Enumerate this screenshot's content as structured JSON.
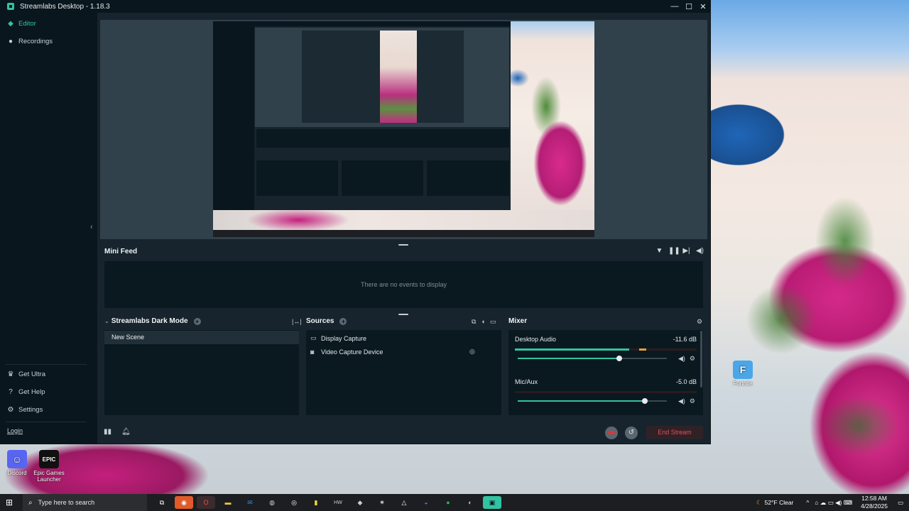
{
  "window": {
    "title": "Streamlabs Desktop - 1.18.3",
    "min": "—",
    "max": "☐",
    "close": "✕"
  },
  "sidebar": {
    "items": [
      {
        "label": "Editor",
        "icon": "◆"
      },
      {
        "label": "Recordings",
        "icon": "●"
      }
    ],
    "bottom": [
      {
        "label": "Get Ultra",
        "icon": "♛"
      },
      {
        "label": "Get Help",
        "icon": "?"
      },
      {
        "label": "Settings",
        "icon": "⚙"
      }
    ],
    "login": "Login"
  },
  "mini_feed": {
    "title": "Mini Feed",
    "empty": "There are no events to display"
  },
  "scenes": {
    "title": "Streamlabs Dark Mode",
    "items": [
      "New Scene"
    ]
  },
  "sources": {
    "title": "Sources",
    "items": [
      "Display Capture",
      "Video Capture Device"
    ]
  },
  "mixer": {
    "title": "Mixer",
    "channels": [
      {
        "name": "Desktop Audio",
        "db": "-11.6 dB",
        "level": 0.63,
        "volume": 0.68
      },
      {
        "name": "Mic/Aux",
        "db": "-5.0 dB",
        "level": 0.0,
        "volume": 0.85
      }
    ]
  },
  "footer": {
    "end_stream": "End Stream"
  },
  "desktop": {
    "icons": [
      {
        "label": "Discord",
        "glyph": "☺"
      },
      {
        "label": "Epic Games Launcher",
        "glyph": "EPIC"
      },
      {
        "label": "Fortnite",
        "glyph": "F"
      }
    ]
  },
  "taskbar": {
    "search_placeholder": "Type here to search",
    "weather": "52°F  Clear",
    "time": "12:58 AM",
    "date": "4/28/2025"
  },
  "colors": {
    "accent": "#31c3a2",
    "danger": "#ea4d56",
    "panel": "#0a1920",
    "bg": "#17242d"
  }
}
